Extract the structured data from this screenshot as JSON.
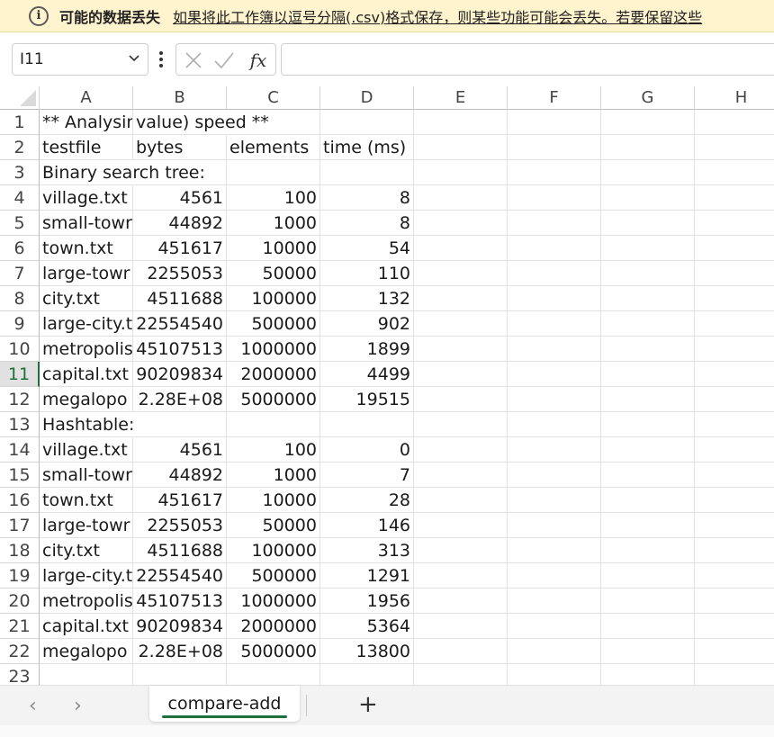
{
  "infobar": {
    "icon": "info-icon",
    "title": "可能的数据丢失",
    "message": "如果将此工作簿以逗号分隔(.csv)格式保存，则某些功能可能会丢失。若要保留这些"
  },
  "formula_bar": {
    "name_box": "I11",
    "formula": ""
  },
  "grid": {
    "columns": [
      "A",
      "B",
      "C",
      "D",
      "E",
      "F",
      "G",
      "H"
    ],
    "rows": [
      "1",
      "2",
      "3",
      "4",
      "5",
      "6",
      "7",
      "8",
      "9",
      "10",
      "11",
      "12",
      "13",
      "14",
      "15",
      "16",
      "17",
      "18",
      "19",
      "20",
      "21",
      "22",
      "23"
    ],
    "selected_row": "11",
    "cells": [
      [
        "** Analysin",
        " value) speed **",
        "",
        "",
        "",
        "",
        "",
        ""
      ],
      [
        "testfile",
        "bytes",
        "elements",
        "time (ms)",
        "",
        "",
        "",
        ""
      ],
      [
        "Binary search tree:",
        "",
        "",
        "",
        "",
        "",
        "",
        ""
      ],
      [
        "village.txt",
        "4561",
        "100",
        "8",
        "",
        "",
        "",
        ""
      ],
      [
        "small-towr",
        "44892",
        "1000",
        "8",
        "",
        "",
        "",
        ""
      ],
      [
        "town.txt",
        "451617",
        "10000",
        "54",
        "",
        "",
        "",
        ""
      ],
      [
        "large-towr",
        "2255053",
        "50000",
        "110",
        "",
        "",
        "",
        ""
      ],
      [
        "city.txt",
        "4511688",
        "100000",
        "132",
        "",
        "",
        "",
        ""
      ],
      [
        "large-city.t",
        "22554540",
        "500000",
        "902",
        "",
        "",
        "",
        ""
      ],
      [
        "metropolis",
        "45107513",
        "1000000",
        "1899",
        "",
        "",
        "",
        ""
      ],
      [
        "capital.txt",
        "90209834",
        "2000000",
        "4499",
        "",
        "",
        "",
        ""
      ],
      [
        "megalopo",
        "2.28E+08",
        "5000000",
        "19515",
        "",
        "",
        "",
        ""
      ],
      [
        "Hashtable:",
        "",
        "",
        "",
        "",
        "",
        "",
        ""
      ],
      [
        "village.txt",
        "4561",
        "100",
        "0",
        "",
        "",
        "",
        ""
      ],
      [
        "small-towr",
        "44892",
        "1000",
        "7",
        "",
        "",
        "",
        ""
      ],
      [
        "town.txt",
        "451617",
        "10000",
        "28",
        "",
        "",
        "",
        ""
      ],
      [
        "large-towr",
        "2255053",
        "50000",
        "146",
        "",
        "",
        "",
        ""
      ],
      [
        "city.txt",
        "4511688",
        "100000",
        "313",
        "",
        "",
        "",
        ""
      ],
      [
        "large-city.t",
        "22554540",
        "500000",
        "1291",
        "",
        "",
        "",
        ""
      ],
      [
        "metropolis",
        "45107513",
        "1000000",
        "1956",
        "",
        "",
        "",
        ""
      ],
      [
        "capital.txt",
        "90209834",
        "2000000",
        "5364",
        "",
        "",
        "",
        ""
      ],
      [
        "megalopo",
        "2.28E+08",
        "5000000",
        "13800",
        "",
        "",
        "",
        ""
      ],
      [
        "",
        "",
        "",
        "",
        "",
        "",
        "",
        ""
      ]
    ]
  },
  "sheet_tabs": {
    "active": "compare-add",
    "add_label": "+"
  },
  "colors": {
    "accent": "#1e6f3c",
    "infobar_bg": "#fff4ce"
  }
}
